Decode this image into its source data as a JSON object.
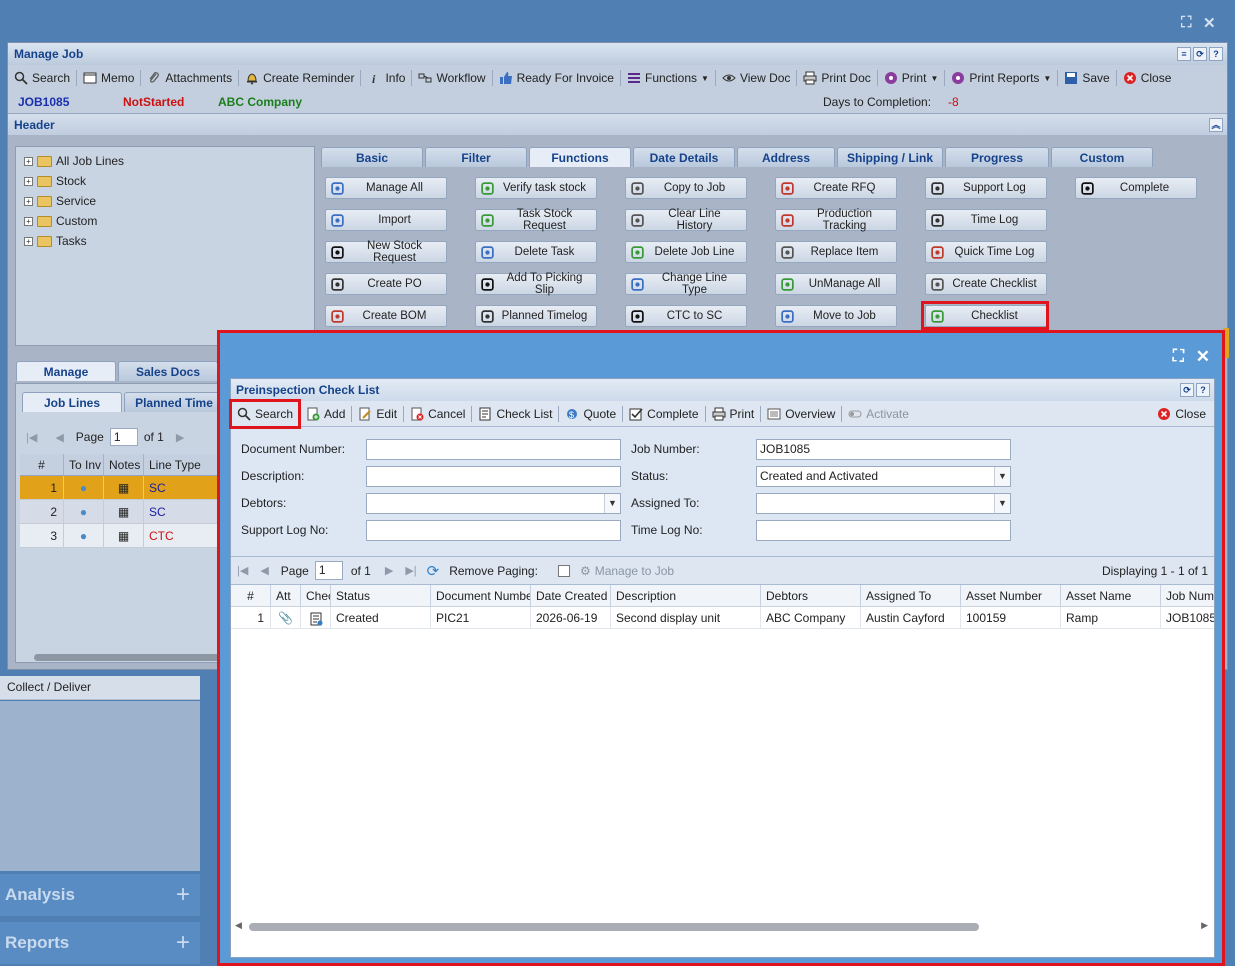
{
  "manage_job": {
    "title": "Manage Job",
    "toolbar": [
      {
        "label": "Search",
        "icon": "search-icon"
      },
      {
        "label": "Memo",
        "icon": "memo-icon"
      },
      {
        "label": "Attachments",
        "icon": "paperclip-icon"
      },
      {
        "label": "Create Reminder",
        "icon": "bell-icon"
      },
      {
        "label": "Info",
        "icon": "info-icon"
      },
      {
        "label": "Workflow",
        "icon": "workflow-icon"
      },
      {
        "label": "Ready For Invoice",
        "icon": "thumbs-up-icon"
      },
      {
        "label": "Functions",
        "icon": "menu-icon"
      },
      {
        "label": "View Doc",
        "icon": "eye-icon"
      },
      {
        "label": "Print Doc",
        "icon": "printer-icon"
      },
      {
        "label": "Print",
        "icon": "print-icon"
      },
      {
        "label": "Print Reports",
        "icon": "report-icon"
      },
      {
        "label": "Save",
        "icon": "save-icon"
      },
      {
        "label": "Close",
        "icon": "close-icon"
      }
    ],
    "job_number": "JOB1085",
    "job_status": "NotStarted",
    "company": "ABC Company",
    "days_label": "Days to Completion:",
    "days_value": "-8",
    "header_title": "Header",
    "tree": [
      "All Job Lines",
      "Stock",
      "Service",
      "Custom",
      "Tasks"
    ],
    "tabs": [
      "Basic",
      "Filter",
      "Functions",
      "Date Details",
      "Address",
      "Shipping / Link",
      "Progress",
      "Custom"
    ],
    "function_buttons": [
      "Manage All",
      "Verify task stock",
      "Copy to Job",
      "Create RFQ",
      "Support Log",
      "Complete",
      "Import",
      "Task Stock Request",
      "Clear Line History",
      "Production Tracking",
      "Time Log",
      "New Stock Request",
      "Delete Task",
      "Delete Job Line",
      "Replace Item",
      "Quick Time Log",
      "Create PO",
      "Add To Picking Slip",
      "Change Line Type",
      "UnManage All",
      "Create Checklist",
      "Create BOM",
      "Planned Timelog",
      "CTC to SC",
      "Move to Job",
      "Checklist"
    ],
    "lower_tabs": [
      "Manage",
      "Sales Docs"
    ],
    "sub_tabs": [
      "Job Lines",
      "Planned Time"
    ],
    "pager": {
      "page_label": "Page",
      "page": "1",
      "of": "of 1"
    },
    "lines_headers": [
      "#",
      "To Inv",
      "Notes",
      "Line Type"
    ],
    "lines": [
      {
        "n": "1",
        "type": "SC",
        "color": "#1a1aa0"
      },
      {
        "n": "2",
        "type": "SC",
        "color": "#1a1aa0"
      },
      {
        "n": "3",
        "type": "CTC",
        "color": "#cc1111"
      }
    ]
  },
  "sidebar": {
    "collect_deliver": "Collect / Deliver",
    "analysis": "Analysis",
    "reports": "Reports"
  },
  "checklist": {
    "title": "Preinspection Check List",
    "toolbar": [
      {
        "label": "Search",
        "icon": "search-icon"
      },
      {
        "label": "Add",
        "icon": "add-icon"
      },
      {
        "label": "Edit",
        "icon": "edit-icon"
      },
      {
        "label": "Cancel",
        "icon": "cancel-icon"
      },
      {
        "label": "Check List",
        "icon": "checklist-icon"
      },
      {
        "label": "Quote",
        "icon": "quote-icon"
      },
      {
        "label": "Complete",
        "icon": "complete-icon"
      },
      {
        "label": "Print",
        "icon": "printer-icon"
      },
      {
        "label": "Overview",
        "icon": "overview-icon"
      },
      {
        "label": "Activate",
        "icon": "toggle-icon"
      }
    ],
    "close_label": "Close",
    "form": {
      "document_number_label": "Document Number:",
      "document_number": "",
      "description_label": "Description:",
      "description": "",
      "debtors_label": "Debtors:",
      "debtors": "",
      "support_log_label": "Support Log No:",
      "support_log": "",
      "job_number_label": "Job Number:",
      "job_number": "JOB1085",
      "status_label": "Status:",
      "status": "Created and Activated",
      "assigned_to_label": "Assigned To:",
      "assigned_to": "",
      "time_log_label": "Time Log No:",
      "time_log": ""
    },
    "pager": {
      "page_label": "Page",
      "page": "1",
      "of": "of 1",
      "remove_paging": "Remove Paging:",
      "manage_to_job": "Manage to Job",
      "displaying": "Displaying 1 - 1 of 1"
    },
    "columns": [
      "#",
      "Att",
      "Chec",
      "Status",
      "Document Number",
      "Date Created",
      "Description",
      "Debtors",
      "Assigned To",
      "Asset Number",
      "Asset Name",
      "Job Numb"
    ],
    "rows": [
      {
        "n": "1",
        "status": "Created",
        "doc": "PIC21",
        "date": "2026-06-19",
        "description": "Second display unit",
        "debtors": "ABC Company",
        "assigned": "Austin Cayford",
        "asset_number": "100159",
        "asset_name": "Ramp",
        "job": "JOB1085"
      }
    ]
  }
}
